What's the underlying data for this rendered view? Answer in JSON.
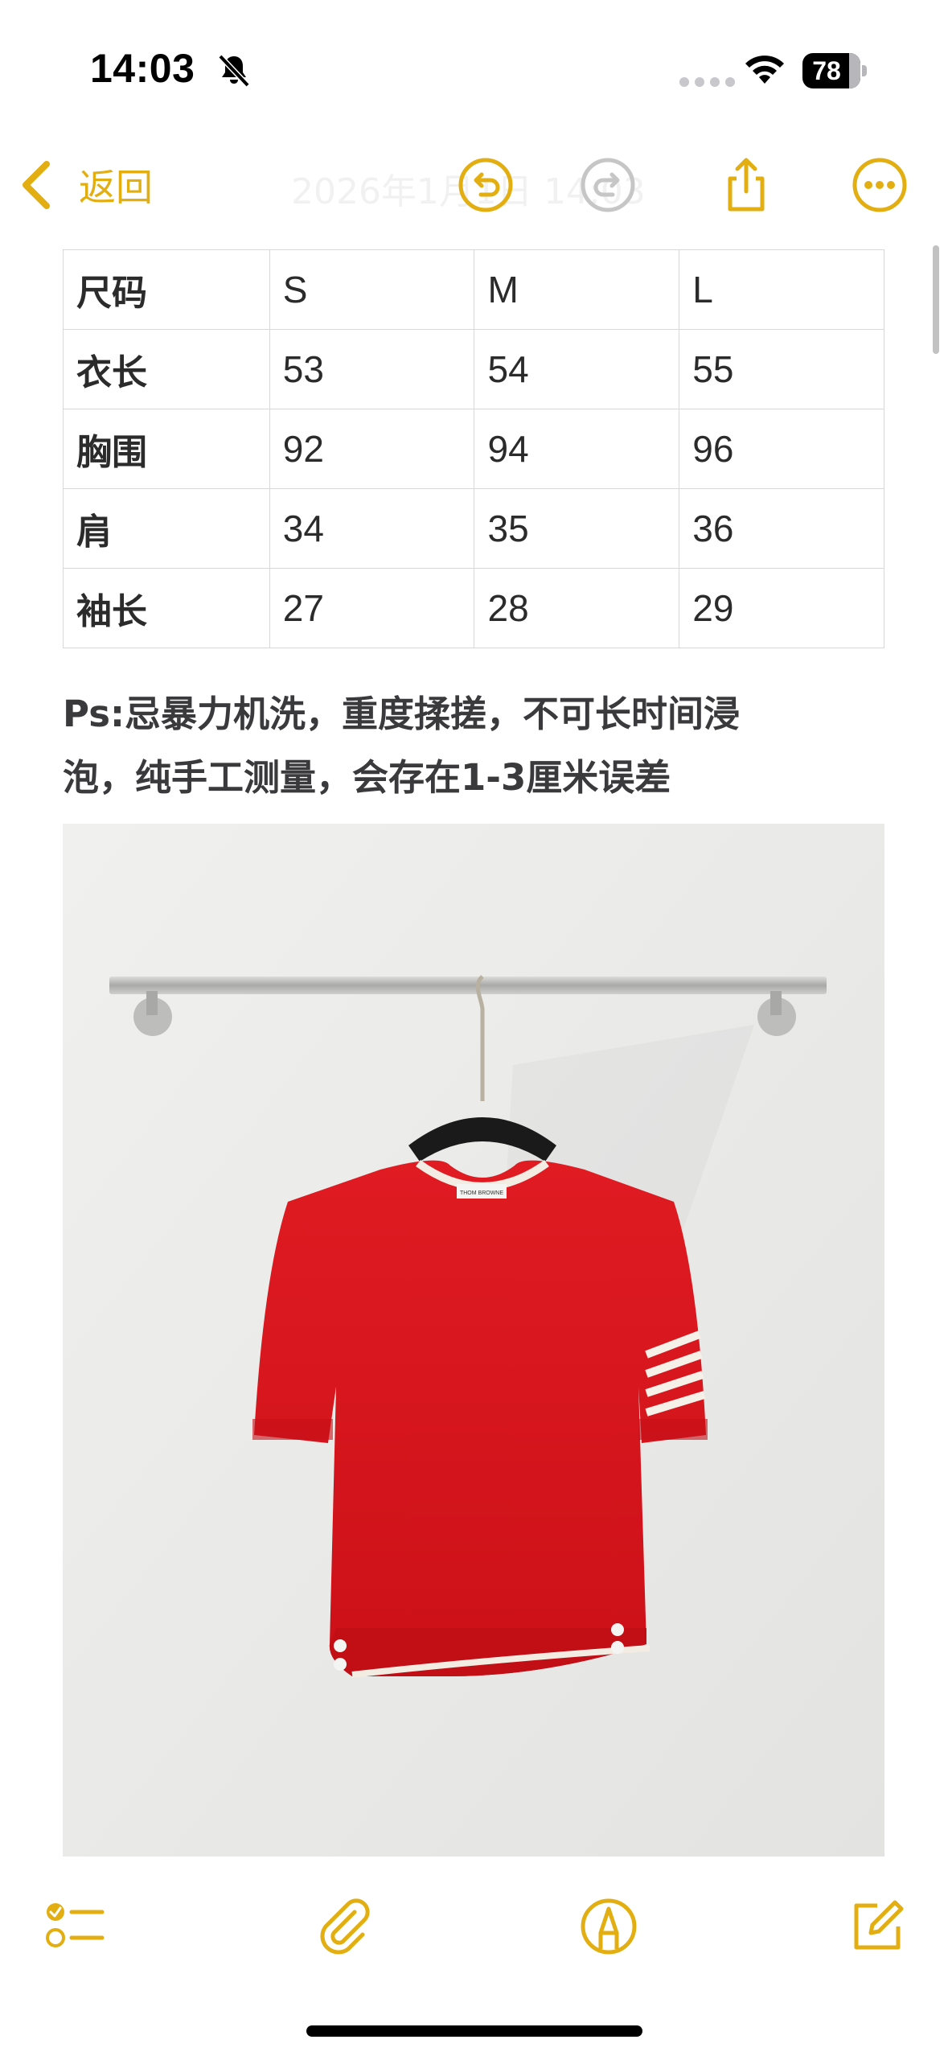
{
  "status_bar": {
    "time": "14:03",
    "battery": "78"
  },
  "nav": {
    "back_label": "返回",
    "faded_title": "2026年1月1日 14:03"
  },
  "table": {
    "header": [
      "尺码",
      "S",
      "M",
      "L"
    ],
    "rows": [
      [
        "衣长",
        "53",
        "54",
        "55"
      ],
      [
        "胸围",
        "92",
        "94",
        "96"
      ],
      [
        "肩",
        "34",
        "35",
        "36"
      ],
      [
        "袖长",
        "27",
        "28",
        "29"
      ]
    ]
  },
  "note": {
    "line1": "Ps:忌暴力机洗，重度揉搓，不可长时间浸",
    "line2": "泡，纯手工测量，会存在1-3厘米误差"
  },
  "photo": {
    "label_text": "THOM BROWNE"
  },
  "colors": {
    "accent": "#e3ae12",
    "shirt": "#d5141c"
  },
  "icons": {
    "undo": "undo-icon",
    "redo": "redo-icon",
    "share": "share-icon",
    "more": "more-icon",
    "checklist": "checklist-icon",
    "attach": "paperclip-icon",
    "markup": "markup-pen-icon",
    "compose": "compose-icon"
  }
}
